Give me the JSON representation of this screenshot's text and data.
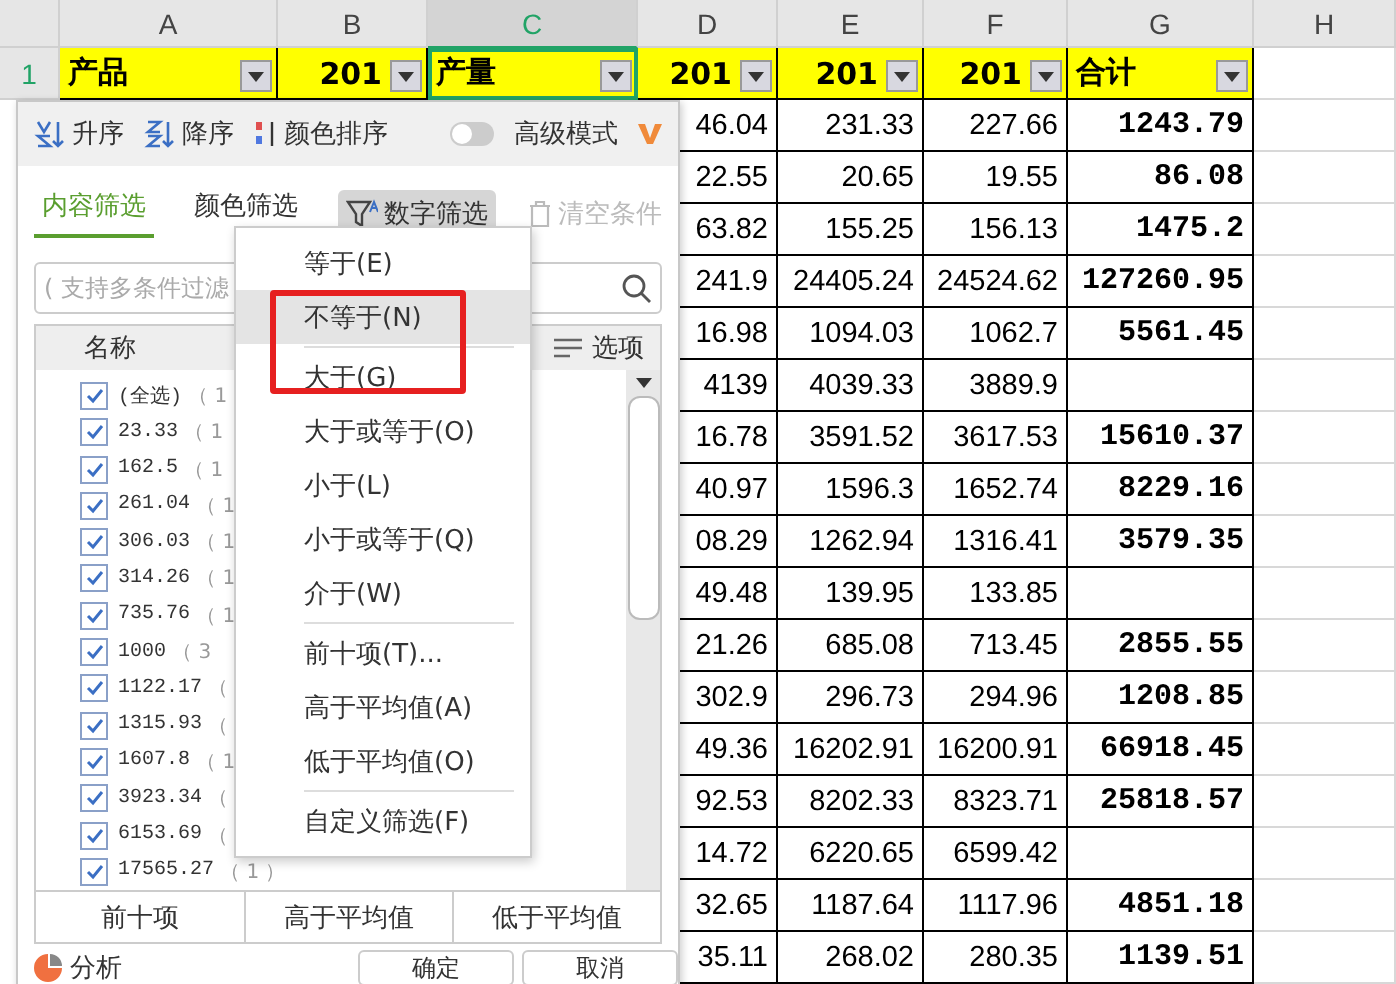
{
  "columns": [
    {
      "label": "A",
      "selected": false
    },
    {
      "label": "B",
      "selected": false
    },
    {
      "label": "C",
      "selected": true
    },
    {
      "label": "D",
      "selected": false
    },
    {
      "label": "E",
      "selected": false
    },
    {
      "label": "F",
      "selected": false
    },
    {
      "label": "G",
      "selected": false
    },
    {
      "label": "H",
      "selected": false
    }
  ],
  "row_number": "1",
  "header_row": [
    {
      "text": "产品",
      "kind": "text"
    },
    {
      "text": "201",
      "kind": "year"
    },
    {
      "text": "产量",
      "kind": "text"
    },
    {
      "text": "201",
      "kind": "year"
    },
    {
      "text": "201",
      "kind": "year"
    },
    {
      "text": "201",
      "kind": "year"
    },
    {
      "text": "合计",
      "kind": "text"
    }
  ],
  "rows": [
    {
      "d": "46.04",
      "e": "231.33",
      "f": "227.66",
      "g": "1243.79"
    },
    {
      "d": "22.55",
      "e": "20.65",
      "f": "19.55",
      "g": "86.08"
    },
    {
      "d": "63.82",
      "e": "155.25",
      "f": "156.13",
      "g": "1475.2"
    },
    {
      "d": "241.9",
      "e": "24405.24",
      "f": "24524.62",
      "g": "127260.95"
    },
    {
      "d": "16.98",
      "e": "1094.03",
      "f": "1062.7",
      "g": "5561.45"
    },
    {
      "d": "4139",
      "e": "4039.33",
      "f": "3889.9"
    },
    {
      "d": "16.78",
      "e": "3591.52",
      "f": "3617.53",
      "g": "15610.37"
    },
    {
      "d": "40.97",
      "e": "1596.3",
      "f": "1652.74",
      "g": "8229.16"
    },
    {
      "d": "08.29",
      "e": "1262.94",
      "f": "1316.41",
      "g": "3579.35"
    },
    {
      "d": "49.48",
      "e": "139.95",
      "f": "133.85"
    },
    {
      "d": "21.26",
      "e": "685.08",
      "f": "713.45",
      "g": "2855.55"
    },
    {
      "d": "302.9",
      "e": "296.73",
      "f": "294.96",
      "g": "1208.85"
    },
    {
      "d": "49.36",
      "e": "16202.91",
      "f": "16200.91",
      "g": "66918.45"
    },
    {
      "d": "92.53",
      "e": "8202.33",
      "f": "8323.71",
      "g": "25818.57"
    },
    {
      "d": "14.72",
      "e": "6220.65",
      "f": "6599.42"
    },
    {
      "d": "32.65",
      "e": "1187.64",
      "f": "1117.96",
      "g": "4851.18"
    },
    {
      "d": "35.11",
      "e": "268.02",
      "f": "280.35",
      "g": "1139.51"
    }
  ],
  "filter_panel": {
    "sort": [
      "升序",
      "降序",
      "颜色排序"
    ],
    "advanced_mode": {
      "label": "高级模式",
      "on": false
    },
    "tabs": [
      {
        "label": "内容筛选",
        "selected": true
      },
      {
        "label": "颜色筛选",
        "selected": false
      }
    ],
    "number_filter": "数字筛选",
    "clear": {
      "label": "清空条件",
      "disabled": true
    },
    "search": {
      "placeholder": "( 支持多条件过滤"
    },
    "list_header": {
      "name": "名称",
      "options": "选项"
    },
    "items": [
      {
        "label": "(全选)",
        "count": "（ 1",
        "checked": true
      },
      {
        "label": "23.33",
        "count": "（ 1",
        "checked": true
      },
      {
        "label": "162.5",
        "count": "（ 1",
        "checked": true
      },
      {
        "label": "261.04",
        "count": "（ 1",
        "checked": true
      },
      {
        "label": "306.03",
        "count": "（ 1",
        "checked": true
      },
      {
        "label": "314.26",
        "count": "（ 1",
        "checked": true
      },
      {
        "label": "735.76",
        "count": "（ 1",
        "checked": true
      },
      {
        "label": "1000",
        "count": "（ 3",
        "checked": true
      },
      {
        "label": "1122.17",
        "count": "（",
        "checked": true
      },
      {
        "label": "1315.93",
        "count": "（",
        "checked": true
      },
      {
        "label": "1607.8",
        "count": "（ 1",
        "checked": true
      },
      {
        "label": "3923.34",
        "count": "（",
        "checked": true
      },
      {
        "label": "6153.69",
        "count": "（",
        "checked": true
      },
      {
        "label": "17565.27",
        "count": "（ 1 ）",
        "checked": true
      }
    ],
    "quick_buttons": [
      "前十项",
      "高于平均值",
      "低于平均值"
    ],
    "analysis": "分析",
    "buttons": [
      "确定",
      "取消"
    ]
  },
  "menu": {
    "frame_marked": true,
    "groups": [
      [
        {
          "label": "等于(E)",
          "hovered": false
        },
        {
          "label": "不等于(N)",
          "hovered": true
        }
      ],
      [
        {
          "label": "大于(G)",
          "hovered": false
        },
        {
          "label": "大于或等于(O)",
          "hovered": false
        },
        {
          "label": "小于(L)",
          "hovered": false
        },
        {
          "label": "小于或等于(Q)",
          "hovered": false
        },
        {
          "label": "介于(W)",
          "hovered": false
        }
      ],
      [
        {
          "label": "前十项(T)...",
          "hovered": false
        },
        {
          "label": "高于平均值(A)",
          "hovered": false
        },
        {
          "label": "低于平均值(O)",
          "hovered": false
        }
      ],
      [
        {
          "label": "自定义筛选(F)",
          "hovered": false
        }
      ]
    ]
  }
}
